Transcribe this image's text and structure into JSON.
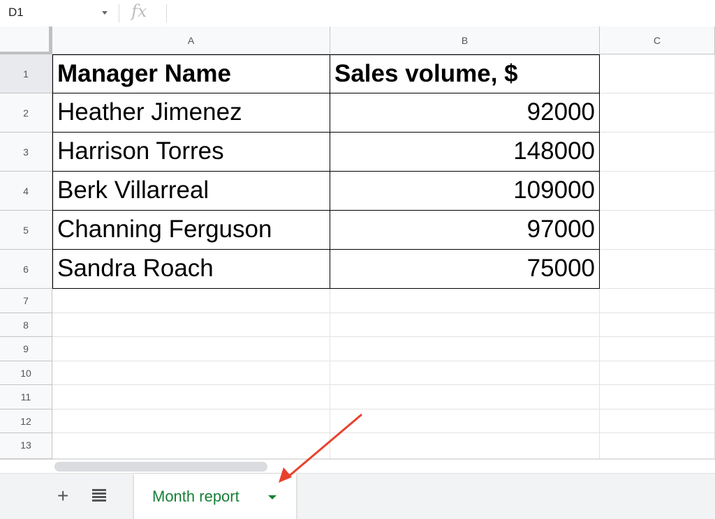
{
  "formula_bar": {
    "name_box": "D1",
    "fx_label": "fx",
    "formula": ""
  },
  "columns": [
    "A",
    "B",
    "C"
  ],
  "rows": [
    "1",
    "2",
    "3",
    "4",
    "5",
    "6",
    "7",
    "8",
    "9",
    "10",
    "11",
    "12",
    "13"
  ],
  "table": {
    "headers": [
      "Manager Name",
      "Sales volume, $"
    ],
    "rows": [
      {
        "name": "Heather Jimenez",
        "sales": "92000"
      },
      {
        "name": "Harrison Torres",
        "sales": "148000"
      },
      {
        "name": "Berk Villarreal",
        "sales": "109000"
      },
      {
        "name": "Channing Ferguson",
        "sales": "97000"
      },
      {
        "name": "Sandra Roach",
        "sales": "75000"
      }
    ]
  },
  "sheets": {
    "add_icon": "+",
    "active_tab": "Month report"
  },
  "colors": {
    "sheet_tab_text": "#188038",
    "annotation_arrow": "#e8412c"
  }
}
